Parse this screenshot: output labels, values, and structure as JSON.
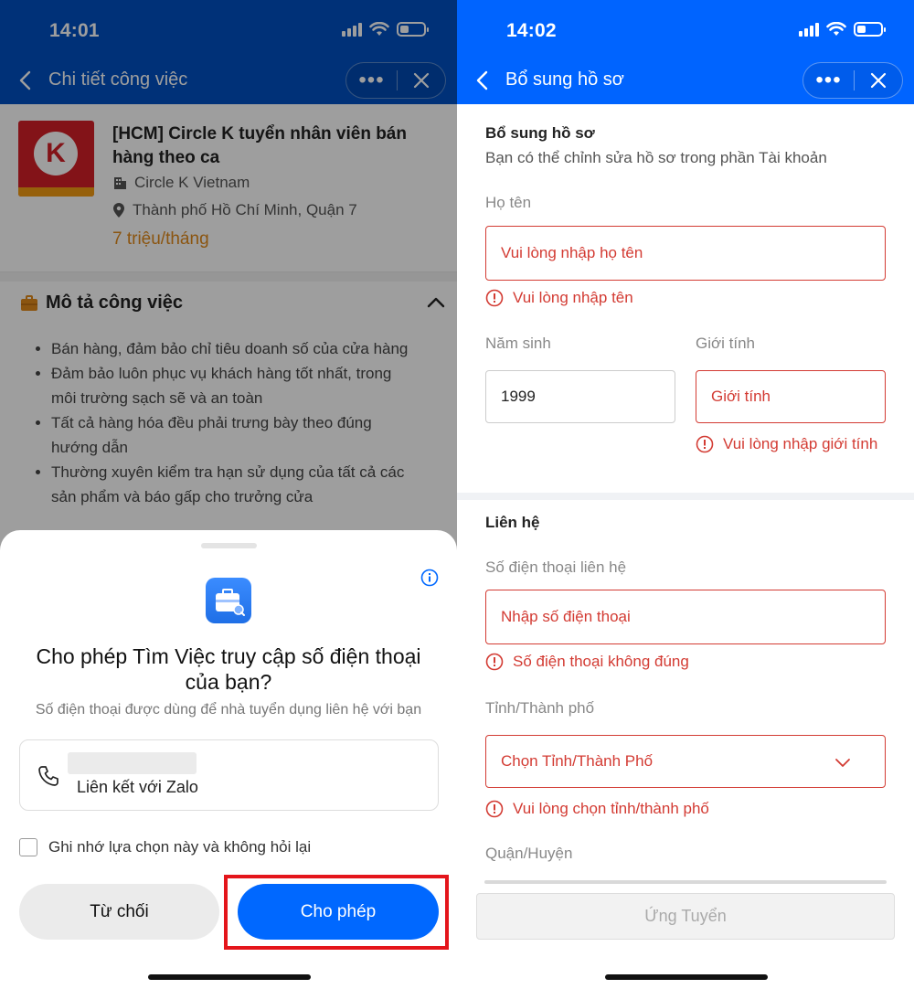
{
  "left": {
    "status": {
      "time": "14:01"
    },
    "nav": {
      "title": "Chi tiết công việc",
      "more": "•••"
    },
    "job": {
      "title": "[HCM] Circle K tuyển nhân viên bán hàng theo ca",
      "company": "Circle K Vietnam",
      "location": "Thành phố Hồ Chí Minh, Quận 7",
      "salary": "7 triệu/tháng",
      "logo_letter": "K"
    },
    "description": {
      "heading": "Mô tả công việc",
      "items": [
        "Bán hàng, đảm bảo chỉ tiêu doanh số của cửa hàng",
        "Đảm bảo luôn phục vụ khách hàng tốt nhất, trong môi trường sạch sẽ và an toàn",
        "Tất cả hàng hóa đều phải trưng bày theo đúng hướng dẫn",
        "Thường xuyên kiểm tra hạn sử dụng của tất cả các sản phẩm và báo gấp cho trưởng cửa"
      ]
    },
    "permission": {
      "title": "Cho phép Tìm Việc truy cập số điện thoại của bạn?",
      "subtitle": "Số điện thoại được dùng để nhà tuyển dụng liên hệ với bạn",
      "option_label": "Liên kết với Zalo",
      "remember": "Ghi nhớ lựa chọn này và không hỏi lại",
      "deny": "Từ chối",
      "allow": "Cho phép"
    }
  },
  "right": {
    "status": {
      "time": "14:02"
    },
    "nav": {
      "title": "Bổ sung hồ sơ",
      "more": "•••"
    },
    "profile": {
      "heading": "Bổ sung hồ sơ",
      "subtitle": "Bạn có thể chỉnh sửa hồ sơ trong phần Tài khoản",
      "name_label": "Họ tên",
      "name_placeholder": "Vui lòng nhập họ tên",
      "name_error": "Vui lòng nhập tên",
      "birth_label": "Năm sinh",
      "birth_value": "1999",
      "gender_label": "Giới tính",
      "gender_placeholder": "Giới tính",
      "gender_error": "Vui lòng nhập giới tính"
    },
    "contact": {
      "heading": "Liên hệ",
      "phone_label": "Số điện thoại liên hệ",
      "phone_placeholder": "Nhập số điện thoại",
      "phone_error": "Số điện thoại không đúng",
      "province_label": "Tỉnh/Thành phố",
      "province_placeholder": "Chọn Tỉnh/Thành Phố",
      "province_error": "Vui lòng chọn tỉnh/thành phố",
      "district_label": "Quận/Huyện"
    },
    "apply_button": "Ứng Tuyển"
  },
  "colors": {
    "left_header": "#0050c2",
    "right_header": "#0064ff",
    "primary_button": "#0068ff",
    "error": "#d33b33",
    "salary": "#e0891b",
    "highlight_box": "#e4151b"
  },
  "icons": [
    "back-icon",
    "more-icon",
    "close-icon",
    "building-icon",
    "location-icon",
    "briefcase-icon",
    "chevron-up-icon",
    "info-icon",
    "app-icon",
    "phone-icon",
    "error-icon",
    "chevron-down-icon"
  ]
}
